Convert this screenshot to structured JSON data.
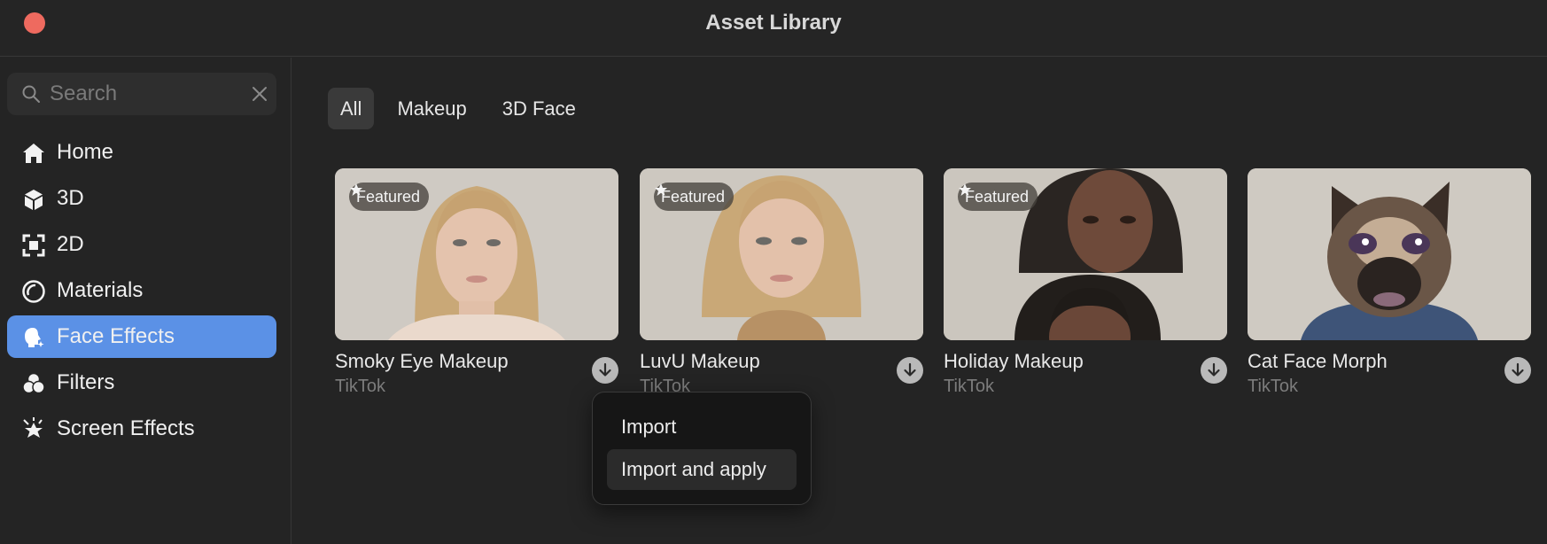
{
  "window": {
    "title": "Asset Library"
  },
  "search": {
    "placeholder": "Search"
  },
  "sidebar": {
    "items": [
      {
        "label": "Home",
        "icon": "home-icon",
        "active": false
      },
      {
        "label": "3D",
        "icon": "cube-icon",
        "active": false
      },
      {
        "label": "2D",
        "icon": "frame-icon",
        "active": false
      },
      {
        "label": "Materials",
        "icon": "material-sphere-icon",
        "active": false
      },
      {
        "label": "Face Effects",
        "icon": "face-effects-icon",
        "active": true
      },
      {
        "label": "Filters",
        "icon": "filters-icon",
        "active": false
      },
      {
        "label": "Screen Effects",
        "icon": "sparkle-icon",
        "active": false
      }
    ]
  },
  "tabs": [
    {
      "label": "All",
      "active": true
    },
    {
      "label": "Makeup",
      "active": false
    },
    {
      "label": "3D Face",
      "active": false
    }
  ],
  "cards": [
    {
      "title": "Smoky Eye Makeup",
      "author": "TikTok",
      "badge": "Featured"
    },
    {
      "title": "LuvU Makeup",
      "author": "TikTok",
      "badge": "Featured"
    },
    {
      "title": "Holiday Makeup",
      "author": "TikTok",
      "badge": "Featured"
    },
    {
      "title": "Cat Face Morph",
      "author": "TikTok",
      "badge": ""
    }
  ],
  "menu": {
    "items": [
      {
        "label": "Import"
      },
      {
        "label": "Import and apply"
      }
    ]
  },
  "colors": {
    "accent": "#5b91e6",
    "close": "#ee6a5f",
    "background": "#242424"
  }
}
